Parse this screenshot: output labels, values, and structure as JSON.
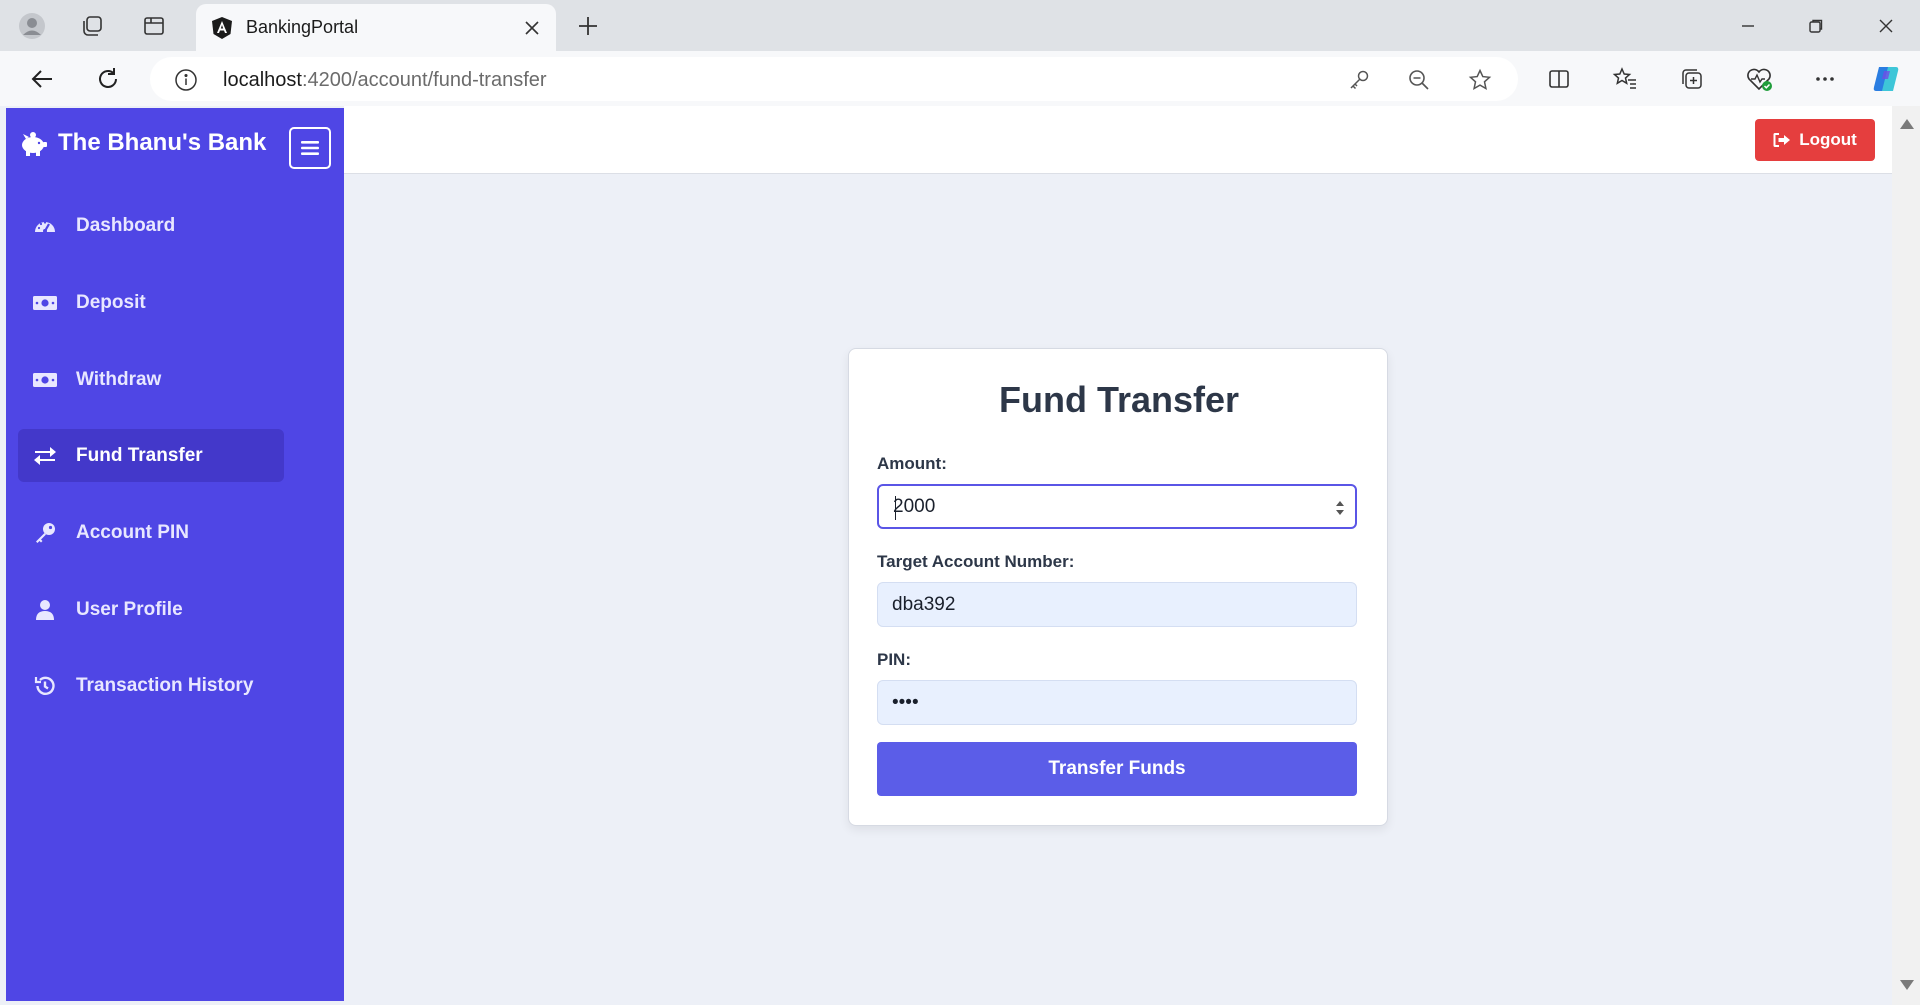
{
  "browser": {
    "tab_title": "BankingPortal",
    "url_host": "localhost",
    "url_path": ":4200/account/fund-transfer"
  },
  "app": {
    "brand_name": "The Bhanu's Bank",
    "logout_label": "Logout",
    "accent_color": "#4f46e5",
    "logout_color": "#e53e3e"
  },
  "sidebar": {
    "items": [
      {
        "label": "Dashboard",
        "icon": "gauge-icon",
        "active": false
      },
      {
        "label": "Deposit",
        "icon": "money-bill-icon",
        "active": false
      },
      {
        "label": "Withdraw",
        "icon": "money-bill-icon",
        "active": false
      },
      {
        "label": "Fund Transfer",
        "icon": "exchange-icon",
        "active": true
      },
      {
        "label": "Account PIN",
        "icon": "key-icon",
        "active": false
      },
      {
        "label": "User Profile",
        "icon": "user-icon",
        "active": false
      },
      {
        "label": "Transaction History",
        "icon": "history-icon",
        "active": false
      }
    ]
  },
  "form": {
    "title": "Fund Transfer",
    "amount_label": "Amount:",
    "amount_value": "2000",
    "target_label": "Target Account Number:",
    "target_value": "dba392",
    "pin_label": "PIN:",
    "pin_value": "••••",
    "submit_label": "Transfer Funds"
  }
}
